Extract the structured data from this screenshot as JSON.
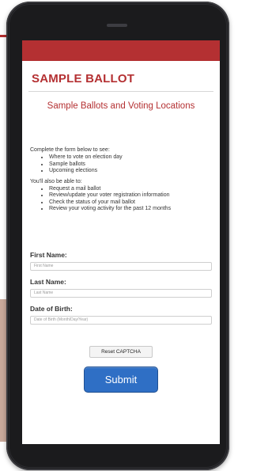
{
  "brand": {
    "title": "SAMPLE BALLOT"
  },
  "page": {
    "subtitle": "Sample Ballots and Voting Locations"
  },
  "intro": {
    "lead": "Complete the form below to see:",
    "items": [
      "Where to vote on election day",
      "Sample ballots",
      "Upcoming elections"
    ],
    "also_lead": "You'll also be able to:",
    "also_items": [
      "Request a mail ballot",
      "Review/update your voter registration information",
      "Check the status of your mail ballot",
      "Review your voting activity for the past 12 months"
    ]
  },
  "form": {
    "first_name_label": "First Name:",
    "first_name_placeholder": "First Name",
    "last_name_label": "Last Name:",
    "last_name_placeholder": "Last Name",
    "dob_label": "Date of Birth:",
    "dob_placeholder": "Date of Birth (Month/Day/Year)",
    "captcha_label": "Reset CAPTCHA",
    "submit_label": "Submit"
  },
  "colors": {
    "brand_red": "#b43032",
    "submit_blue": "#2f6fc5"
  }
}
